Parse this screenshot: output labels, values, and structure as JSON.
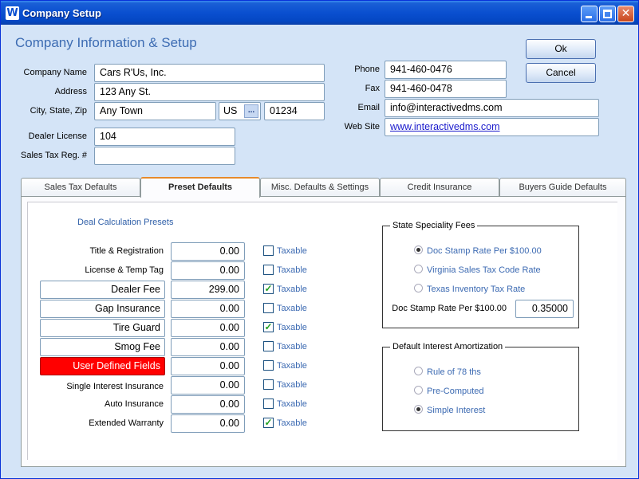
{
  "window": {
    "title": "Company Setup",
    "app_icon": "W"
  },
  "header": {
    "title": "Company Information & Setup"
  },
  "company": {
    "name_label": "Company Name",
    "name": "Cars R'Us, Inc.",
    "address_label": "Address",
    "address": "123 Any St.",
    "csz_label": "City, State, Zip",
    "city": "Any Town",
    "state": "US",
    "zip": "01234",
    "state_button": "...",
    "license_label": "Dealer License",
    "license": "104",
    "salestax_label": "Sales Tax Reg. #",
    "salestax": "",
    "phone_label": "Phone",
    "phone": "941-460-0476",
    "fax_label": "Fax",
    "fax": "941-460-0478",
    "email_label": "Email",
    "email": "info@interactivedms.com",
    "website_label": "Web Site",
    "website": "www.interactivedms.com"
  },
  "buttons": {
    "ok": "Ok",
    "cancel": "Cancel"
  },
  "tabs": [
    {
      "label": "Sales Tax Defaults"
    },
    {
      "label": "Preset Defaults"
    },
    {
      "label": "Misc. Defaults & Settings"
    },
    {
      "label": "Credit Insurance"
    },
    {
      "label": "Buyers Guide Defaults"
    }
  ],
  "presets": {
    "section_title": "Deal Calculation Presets",
    "taxable_label": "Taxable",
    "rows": [
      {
        "label": "Title & Registration",
        "value": "0.00",
        "taxable": false,
        "kind": "label"
      },
      {
        "label": "License & Temp Tag",
        "value": "0.00",
        "taxable": false,
        "kind": "label"
      },
      {
        "label": "Dealer Fee",
        "value": "299.00",
        "taxable": true,
        "kind": "button"
      },
      {
        "label": "Gap Insurance",
        "value": "0.00",
        "taxable": false,
        "kind": "button"
      },
      {
        "label": "Tire Guard",
        "value": "0.00",
        "taxable": true,
        "kind": "button"
      },
      {
        "label": "Smog Fee",
        "value": "0.00",
        "taxable": false,
        "kind": "button"
      },
      {
        "label": "User Defined Fields",
        "value": "0.00",
        "taxable": false,
        "kind": "button-red"
      },
      {
        "label": "Single Interest Insurance",
        "value": "0.00",
        "taxable": false,
        "kind": "label"
      },
      {
        "label": "Auto Insurance",
        "value": "0.00",
        "taxable": false,
        "kind": "label"
      },
      {
        "label": "Extended Warranty",
        "value": "0.00",
        "taxable": true,
        "kind": "label"
      }
    ]
  },
  "state_fees": {
    "title": "State Speciality Fees",
    "options": [
      {
        "label": "Doc Stamp Rate Per $100.00",
        "selected": true
      },
      {
        "label": "Virginia Sales Tax Code Rate",
        "selected": false
      },
      {
        "label": "Texas Inventory Tax Rate",
        "selected": false
      }
    ],
    "rate_label": "Doc Stamp Rate Per $100.00",
    "rate_value": "0.35000"
  },
  "amortization": {
    "title": "Default Interest Amortization",
    "options": [
      {
        "label": "Rule of 78 ths",
        "selected": false
      },
      {
        "label": "Pre-Computed",
        "selected": false
      },
      {
        "label": "Simple Interest",
        "selected": true
      }
    ]
  }
}
